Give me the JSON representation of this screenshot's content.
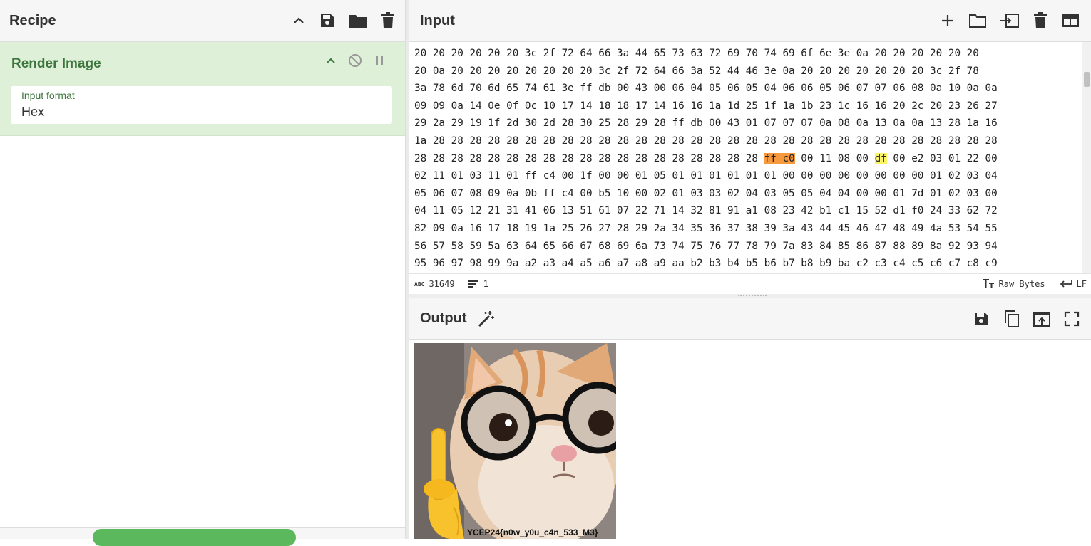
{
  "recipe": {
    "title": "Recipe",
    "operation": {
      "name": "Render Image",
      "field_label": "Input format",
      "field_value": "Hex"
    }
  },
  "input": {
    "title": "Input",
    "hex_lines": [
      "20 20 20 20 20 20 3c 2f 72 64 66 3a 44 65 73 63 72 69 70 74 69 6f 6e 3e 0a 20 20 20 20 20 20",
      "20 0a 20 20 20 20 20 20 20 20 3c 2f 72 64 66 3a 52 44 46 3e 0a 20 20 20 20 20 20 20 3c 2f 78",
      "3a 78 6d 70 6d 65 74 61 3e ff db 00 43 00 06 04 05 06 05 04 06 06 05 06 07 07 06 08 0a 10 0a 0a",
      "09 09 0a 14 0e 0f 0c 10 17 14 18 18 17 14 16 16 1a 1d 25 1f 1a 1b 23 1c 16 16 20 2c 20 23 26 27",
      "29 2a 29 19 1f 2d 30 2d 28 30 25 28 29 28 ff db 00 43 01 07 07 07 0a 08 0a 13 0a 0a 13 28 1a 16",
      "1a 28 28 28 28 28 28 28 28 28 28 28 28 28 28 28 28 28 28 28 28 28 28 28 28 28 28 28 28 28 28 28",
      "28 28 28 28 28 28 28 28 28 28 28 28 28 28 28 28 28 28 28 |ff c0| 00 11 08 00 #df# 00 e2 03 01 22 00",
      "02 11 01 03 11 01 ff c4 00 1f 00 00 01 05 01 01 01 01 01 01 00 00 00 00 00 00 00 00 01 02 03 04",
      "05 06 07 08 09 0a 0b ff c4 00 b5 10 00 02 01 03 03 02 04 03 05 05 04 04 00 00 01 7d 01 02 03 00",
      "04 11 05 12 21 31 41 06 13 51 61 07 22 71 14 32 81 91 a1 08 23 42 b1 c1 15 52 d1 f0 24 33 62 72",
      "82 09 0a 16 17 18 19 1a 25 26 27 28 29 2a 34 35 36 37 38 39 3a 43 44 45 46 47 48 49 4a 53 54 55",
      "56 57 58 59 5a 63 64 65 66 67 68 69 6a 73 74 75 76 77 78 79 7a 83 84 85 86 87 88 89 8a 92 93 94",
      "95 96 97 98 99 9a a2 a3 a4 a5 a6 a7 a8 a9 aa b2 b3 b4 b5 b6 b7 b8 b9 ba c2 c3 c4 c5 c6 c7 c8 c9"
    ],
    "status": {
      "length": "31649",
      "lines": "1",
      "encoding": "Raw Bytes",
      "eol": "LF"
    }
  },
  "output": {
    "title": "Output",
    "image_caption": "YCEP24{n0w_y0u_c4n_533_M3}"
  }
}
